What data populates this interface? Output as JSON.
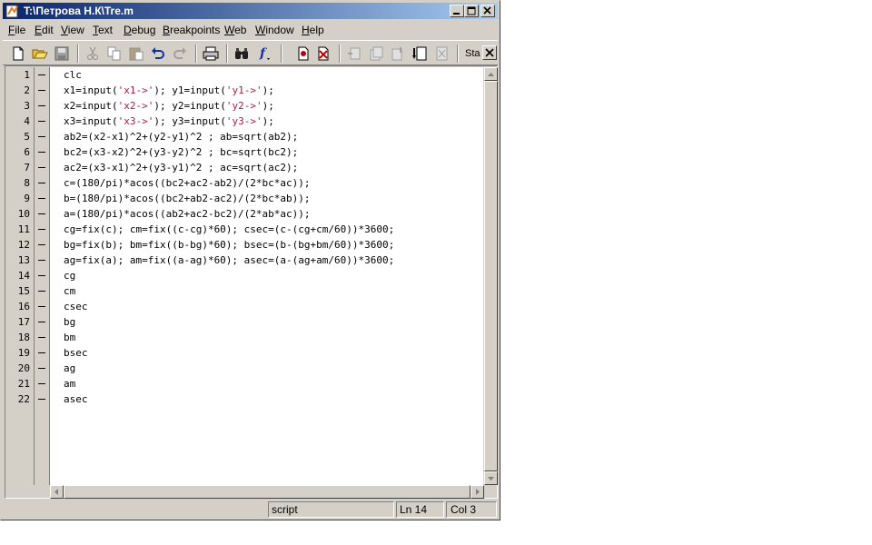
{
  "window": {
    "title": "T:\\Петрова Н.К\\Tre.m"
  },
  "menu": [
    {
      "label": "File",
      "u": "F",
      "rest": "ile"
    },
    {
      "label": "Edit",
      "u": "E",
      "rest": "dit"
    },
    {
      "label": "View",
      "u": "V",
      "rest": "iew"
    },
    {
      "label": "Text",
      "u": "T",
      "rest": "ext"
    },
    {
      "label": "Debug",
      "u": "D",
      "rest": "ebug"
    },
    {
      "label": "Breakpoints",
      "u": "B",
      "rest": "reakpoints"
    },
    {
      "label": "Web",
      "u": "W",
      "rest": "eb"
    },
    {
      "label": "Window",
      "u": "W",
      "rest": "indow"
    },
    {
      "label": "Help",
      "u": "H",
      "rest": "elp"
    }
  ],
  "toolbar": {
    "icons": [
      "new-file-icon",
      "open-folder-icon",
      "save-icon",
      "cut-icon",
      "copy-icon",
      "paste-icon",
      "undo-icon",
      "redo-icon",
      "print-icon",
      "find-icon",
      "function-icon",
      "set-breakpoint-icon",
      "clear-breakpoints-icon",
      "step-icon",
      "step-in-icon",
      "step-out-icon",
      "continue-icon",
      "exit-debug-icon"
    ],
    "stack_label": "Sta"
  },
  "editor": {
    "lines": [
      "clc",
      "x1=input('x1->'); y1=input('y1->');",
      "x2=input('x2->'); y2=input('y2->');",
      "x3=input('x3->'); y3=input('y3->');",
      "ab2=(x2-x1)^2+(y2-y1)^2 ; ab=sqrt(ab2);",
      "bc2=(x3-x2)^2+(y3-y2)^2 ; bc=sqrt(bc2);",
      "ac2=(x3-x1)^2+(y3-y1)^2 ; ac=sqrt(ac2);",
      "c=(180/pi)*acos((bc2+ac2-ab2)/(2*bc*ac));",
      "b=(180/pi)*acos((bc2+ab2-ac2)/(2*bc*ab));",
      "a=(180/pi)*acos((ab2+ac2-bc2)/(2*ab*ac));",
      "cg=fix(c); cm=fix((c-cg)*60); csec=(c-(cg+cm/60))*3600;",
      "bg=fix(b); bm=fix((b-bg)*60); bsec=(b-(bg+bm/60))*3600;",
      "ag=fix(a); am=fix((a-ag)*60); asec=(a-(ag+am/60))*3600;",
      "cg",
      "cm",
      "csec",
      "bg",
      "bm",
      "bsec",
      "ag",
      "am",
      "asec"
    ]
  },
  "status": {
    "mode": "script",
    "line": "Ln 14",
    "col": "Col 3"
  },
  "colors": {
    "title_start": "#0a246a",
    "title_end": "#a6caf0",
    "string": "#a0204a",
    "chrome": "#d4d0c8"
  }
}
